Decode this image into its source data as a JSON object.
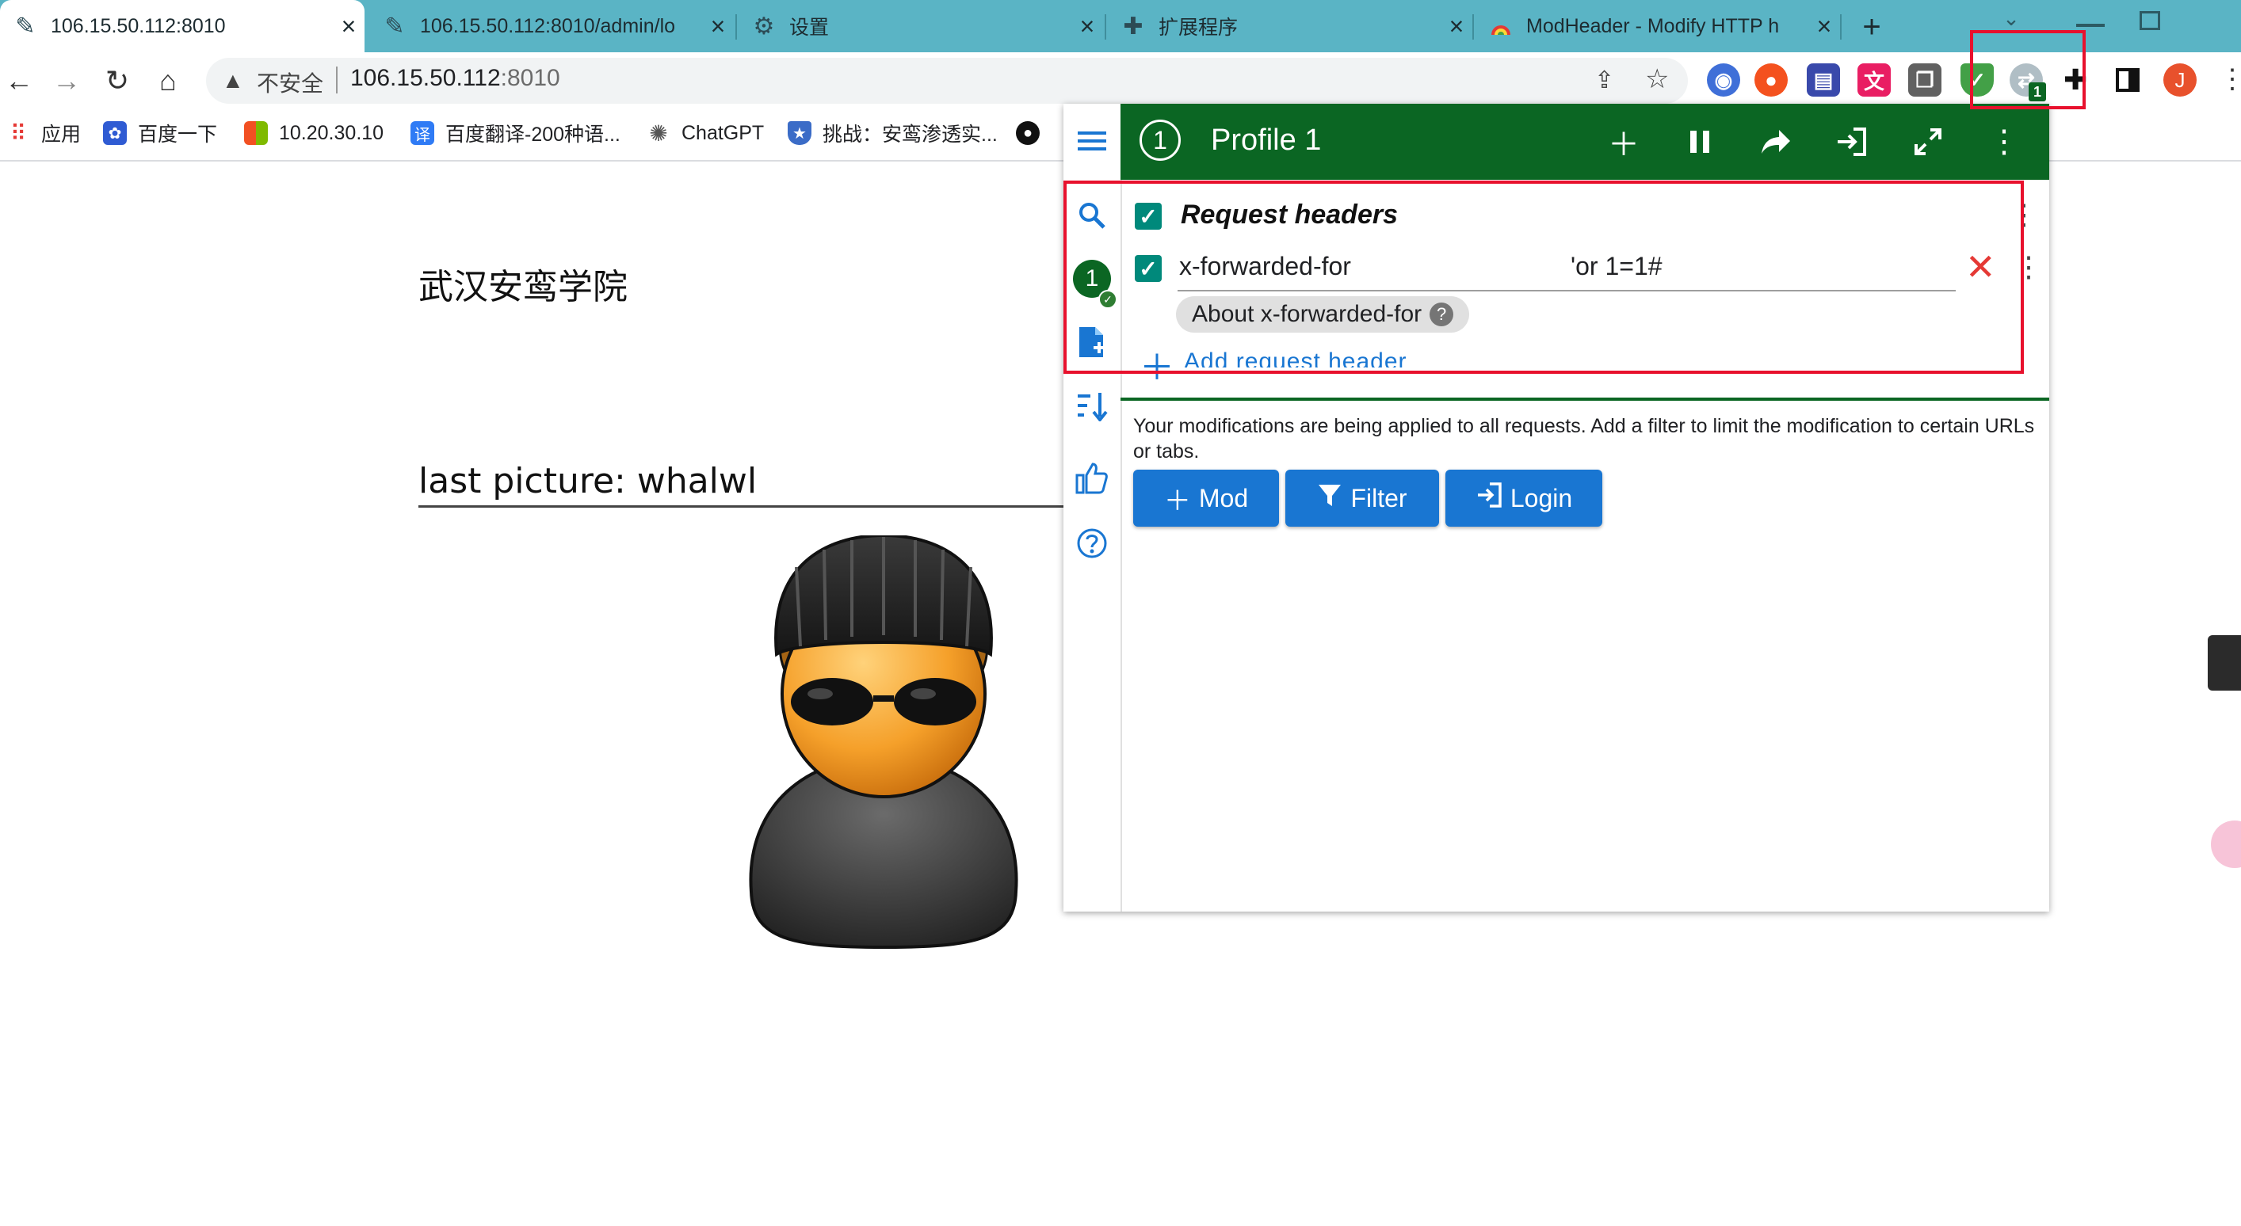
{
  "browser": {
    "tabs": [
      {
        "title": "106.15.50.112:8010",
        "icon": "pen-icon",
        "active": true
      },
      {
        "title": "106.15.50.112:8010/admin/lo",
        "icon": "pen-icon",
        "active": false
      },
      {
        "title": "设置",
        "icon": "gear-icon",
        "active": false
      },
      {
        "title": "扩展程序",
        "icon": "puzzle-icon",
        "active": false
      },
      {
        "title": "ModHeader - Modify HTTP h",
        "icon": "modheader-icon",
        "active": false
      }
    ],
    "new_tab_label": "+",
    "close_label": "×",
    "security_label": "不安全",
    "url_host": "106.15.50.112",
    "url_port": ":8010",
    "profile_initial": "J",
    "extension_badge": "1",
    "bookmarks": [
      {
        "label": "应用",
        "icon": "apps-grid-icon"
      },
      {
        "label": "百度一下",
        "icon": "baidu-paw-icon"
      },
      {
        "label": "10.20.30.10",
        "icon": "windows-logo-icon"
      },
      {
        "label": "百度翻译-200种语...",
        "icon": "translate-icon"
      },
      {
        "label": "ChatGPT",
        "icon": "openai-icon"
      },
      {
        "label": "挑战：安鸾渗透实...",
        "icon": "shield-icon"
      },
      {
        "label": "",
        "icon": "github-icon"
      }
    ]
  },
  "page": {
    "heading": "武汉安鸾学院",
    "caption": "last picture: whalwl"
  },
  "modheader": {
    "profile_number": "1",
    "profile_name": "Profile 1",
    "section_title": "Request headers",
    "header_name": "x-forwarded-for",
    "header_value": "'or 1=1#",
    "about_chip": "About x-forwarded-for",
    "add_header_label": "Add request header",
    "info_text": "Your modifications are being applied to all requests. Add a filter to limit the modification to certain URLs or tabs.",
    "buttons": {
      "mod": "Mod",
      "filter": "Filter",
      "login": "Login"
    },
    "accent_color": "#0b6623",
    "button_color": "#1976d2"
  },
  "annotations": {
    "highlight_color": "#e8112d"
  }
}
